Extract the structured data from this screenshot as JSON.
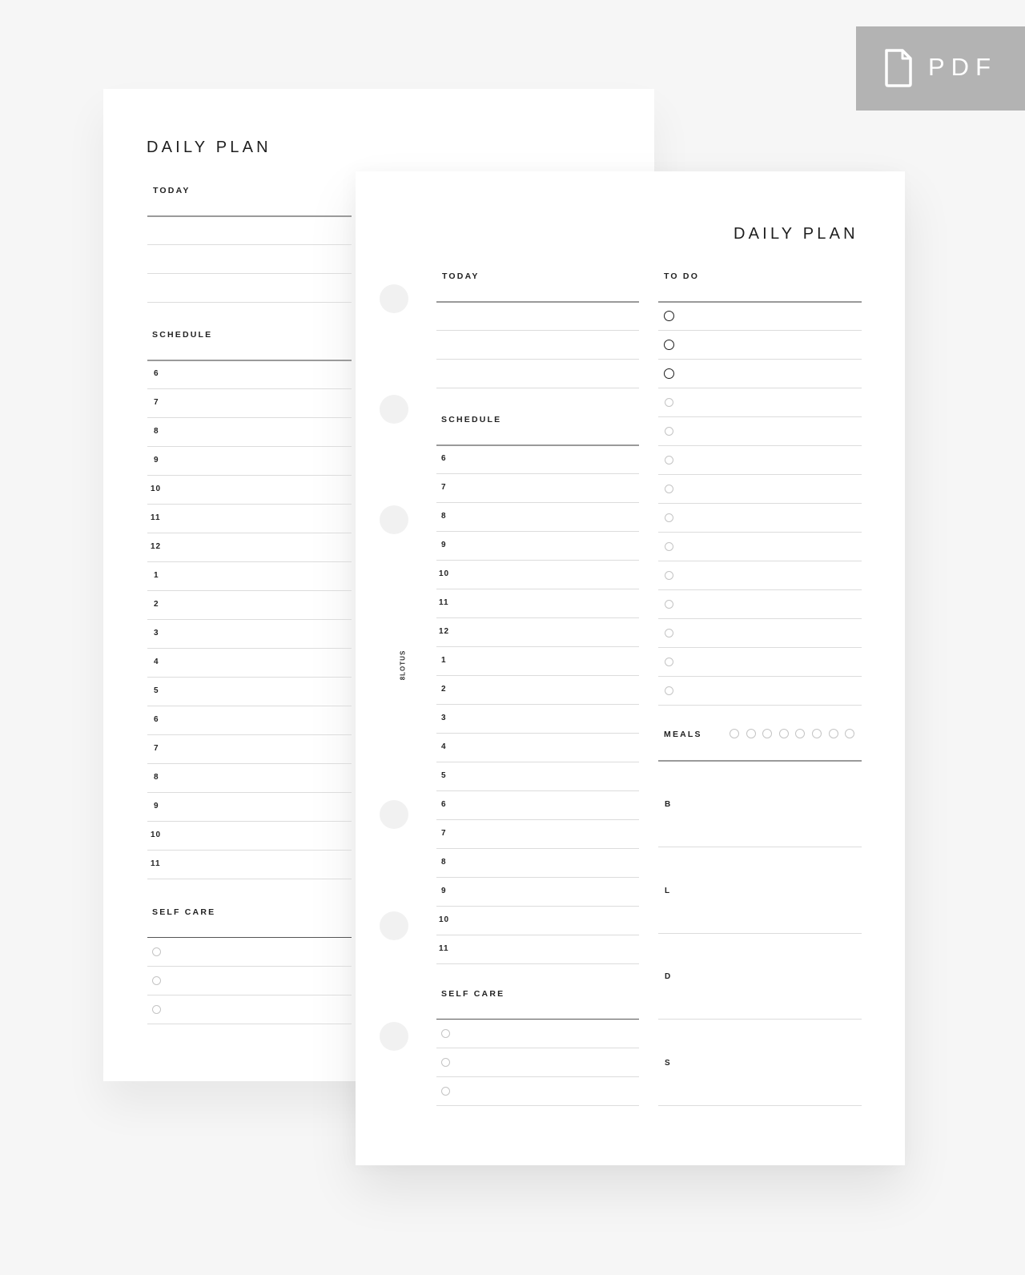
{
  "badge": {
    "label": "PDF",
    "icon": "document-icon"
  },
  "back_page": {
    "title": "DAILY PLAN",
    "today_label": "TODAY",
    "schedule_label": "SCHEDULE",
    "hours": [
      "6",
      "7",
      "8",
      "9",
      "10",
      "11",
      "12",
      "1",
      "2",
      "3",
      "4",
      "5",
      "6",
      "7",
      "8",
      "9",
      "10",
      "11"
    ],
    "self_care_label": "SELF CARE",
    "self_care_items": 3
  },
  "front_page": {
    "title": "DAILY PLAN",
    "today_label": "TODAY",
    "schedule_label": "SCHEDULE",
    "hours": [
      "6",
      "7",
      "8",
      "9",
      "10",
      "11",
      "12",
      "1",
      "2",
      "3",
      "4",
      "5",
      "6",
      "7",
      "8",
      "9",
      "10",
      "11"
    ],
    "self_care_label": "SELF CARE",
    "self_care_items": 3,
    "todo_label": "TO DO",
    "todo_items": 14,
    "todo_highlighted_items": 3,
    "meals_label": "MEALS",
    "water_circles": 8,
    "meal_slots": [
      "B",
      "L",
      "D",
      "S"
    ],
    "brand_mark": "8LOTUS"
  }
}
